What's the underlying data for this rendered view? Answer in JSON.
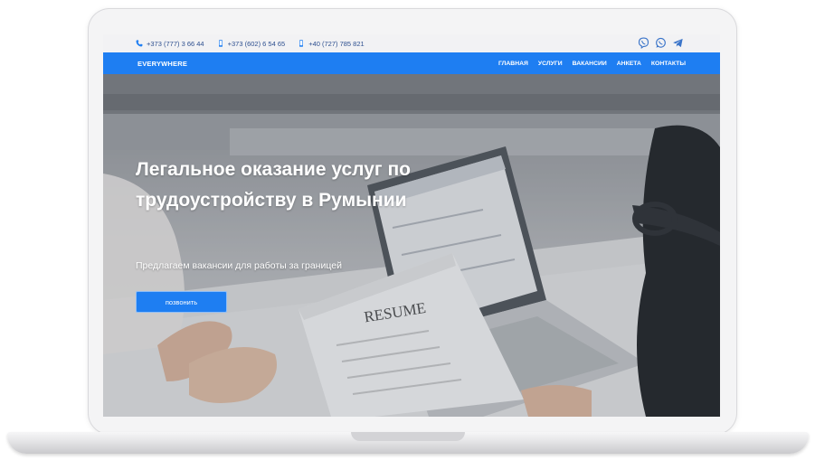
{
  "topbar": {
    "phones": [
      {
        "number": "+373 (777) 3 66 44",
        "icon": "phone-icon"
      },
      {
        "number": "+373 (602) 6 54 65",
        "icon": "mobile-icon"
      },
      {
        "number": "+40 (727) 785 821",
        "icon": "mobile-icon"
      }
    ],
    "social": [
      "viber-icon",
      "whatsapp-icon",
      "telegram-icon"
    ]
  },
  "nav": {
    "brand": "EVERYWHERE",
    "items": [
      "ГЛАВНАЯ",
      "УСЛУГИ",
      "ВАКАНСИИ",
      "АНКЕТА",
      "КОНТАКТЫ"
    ]
  },
  "hero": {
    "title": "Легальное оказание услуг по трудоустройству в Румынии",
    "subtitle": "Предлагаем вакансии для работы за границей",
    "cta_label": "позвонить",
    "photo_text": "RESUME"
  },
  "colors": {
    "accent": "#1e7ef2",
    "topbar_text": "#2d4f8f",
    "topbar_bg": "#f2f2f4"
  }
}
